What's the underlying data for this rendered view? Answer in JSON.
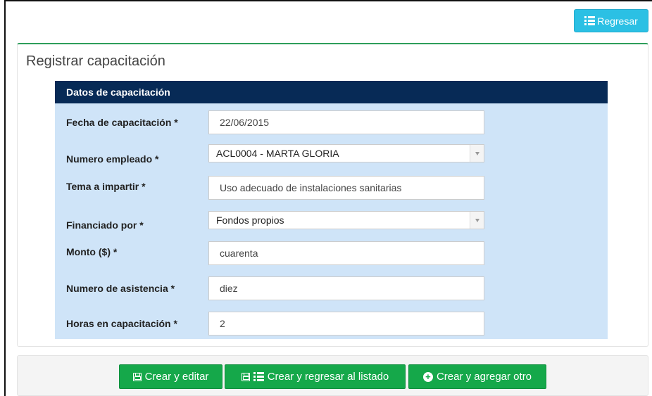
{
  "header": {
    "back_label": "Regresar"
  },
  "form": {
    "title": "Registrar capacitación",
    "section_title": "Datos de capacitación",
    "fields": {
      "fecha": {
        "label": "Fecha de capacitación *",
        "value": "22/06/2015"
      },
      "empleado": {
        "label": "Numero empleado *",
        "value": "ACL0004 - MARTA GLORIA"
      },
      "tema": {
        "label": "Tema a impartir *",
        "value": "Uso adecuado de instalaciones sanitarias"
      },
      "financiado": {
        "label": "Financiado por *",
        "value": "Fondos propios"
      },
      "monto": {
        "label": "Monto ($) *",
        "value": "cuarenta"
      },
      "asistencia": {
        "label": "Numero de asistencia *",
        "value": "diez"
      },
      "horas": {
        "label": "Horas en capacitación *",
        "value": "2"
      }
    }
  },
  "actions": {
    "create_edit": "Crear y editar",
    "create_return": "Crear y regresar al listado",
    "create_add": "Crear y agregar otro"
  },
  "colors": {
    "accent_info": "#2bc0e4",
    "success": "#15a84a",
    "panel_header": "#072a56",
    "panel_bg": "#cfe4f8"
  }
}
